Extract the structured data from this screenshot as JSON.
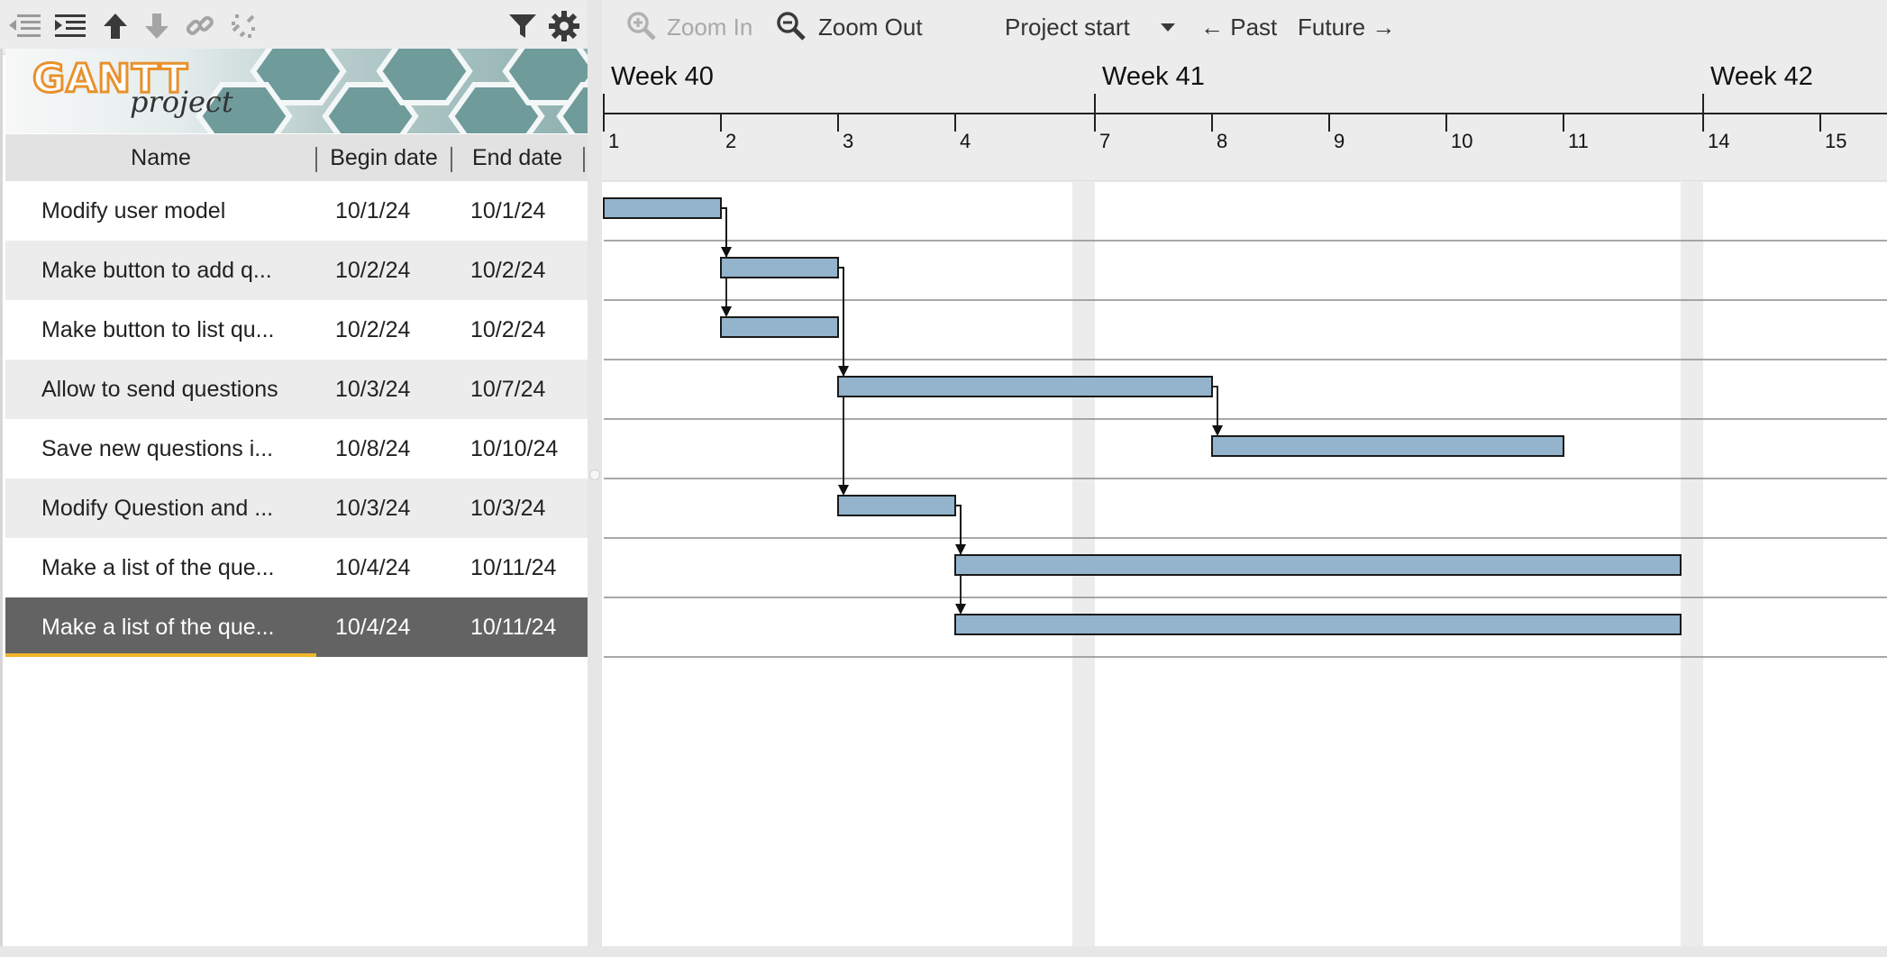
{
  "app": {
    "logo_top": "GANTT",
    "logo_bottom": "project"
  },
  "toolbar": {
    "icons": [
      "unindent-icon",
      "indent-icon",
      "move-up-icon",
      "move-down-icon",
      "link-icon",
      "unlink-icon",
      "filter-icon",
      "settings-icon"
    ],
    "zoom_in": "Zoom In",
    "zoom_out": "Zoom Out",
    "project_start": "Project start",
    "past": "← Past",
    "future": "Future →"
  },
  "table": {
    "columns": {
      "name": "Name",
      "begin": "Begin date",
      "end": "End date"
    },
    "rows": [
      {
        "name": "Modify user model",
        "begin": "10/1/24",
        "end": "10/1/24"
      },
      {
        "name": "Make button to add q...",
        "begin": "10/2/24",
        "end": "10/2/24"
      },
      {
        "name": "Make button to list qu...",
        "begin": "10/2/24",
        "end": "10/2/24"
      },
      {
        "name": "Allow to send questions",
        "begin": "10/3/24",
        "end": "10/7/24"
      },
      {
        "name": "Save new questions i...",
        "begin": "10/8/24",
        "end": "10/10/24"
      },
      {
        "name": "Modify Question and ...",
        "begin": "10/3/24",
        "end": "10/3/24"
      },
      {
        "name": "Make a list of the que...",
        "begin": "10/4/24",
        "end": "10/11/24"
      },
      {
        "name": "Make a list of the que...",
        "begin": "10/4/24",
        "end": "10/11/24"
      }
    ],
    "selected_row": 7
  },
  "timeline": {
    "weeks": [
      {
        "label": "Week 40",
        "day": "1"
      },
      {
        "label": "Week 41",
        "day": "7"
      },
      {
        "label": "Week 42",
        "day": "14"
      }
    ],
    "days": [
      "1",
      "2",
      "3",
      "4",
      "7",
      "8",
      "9",
      "10",
      "11",
      "14",
      "15"
    ],
    "weekends": [
      [
        "5",
        "6"
      ],
      [
        "12",
        "13"
      ]
    ]
  },
  "tasks": [
    {
      "start": "1",
      "end": "1"
    },
    {
      "start": "2",
      "end": "2"
    },
    {
      "start": "2",
      "end": "2"
    },
    {
      "start": "3",
      "end": "7"
    },
    {
      "start": "8",
      "end": "10"
    },
    {
      "start": "3",
      "end": "3"
    },
    {
      "start": "4",
      "end": "11"
    },
    {
      "start": "4",
      "end": "11"
    }
  ],
  "dependencies": [
    [
      0,
      1
    ],
    [
      0,
      2
    ],
    [
      1,
      3
    ],
    [
      1,
      5
    ],
    [
      3,
      4
    ],
    [
      5,
      6
    ],
    [
      5,
      7
    ]
  ],
  "colors": {
    "bar_fill": "#93b4cc",
    "bar_stroke": "#1a1a1a",
    "weekend": "#ececec",
    "selected_row": "#636363",
    "accent": "#f0b42a"
  }
}
